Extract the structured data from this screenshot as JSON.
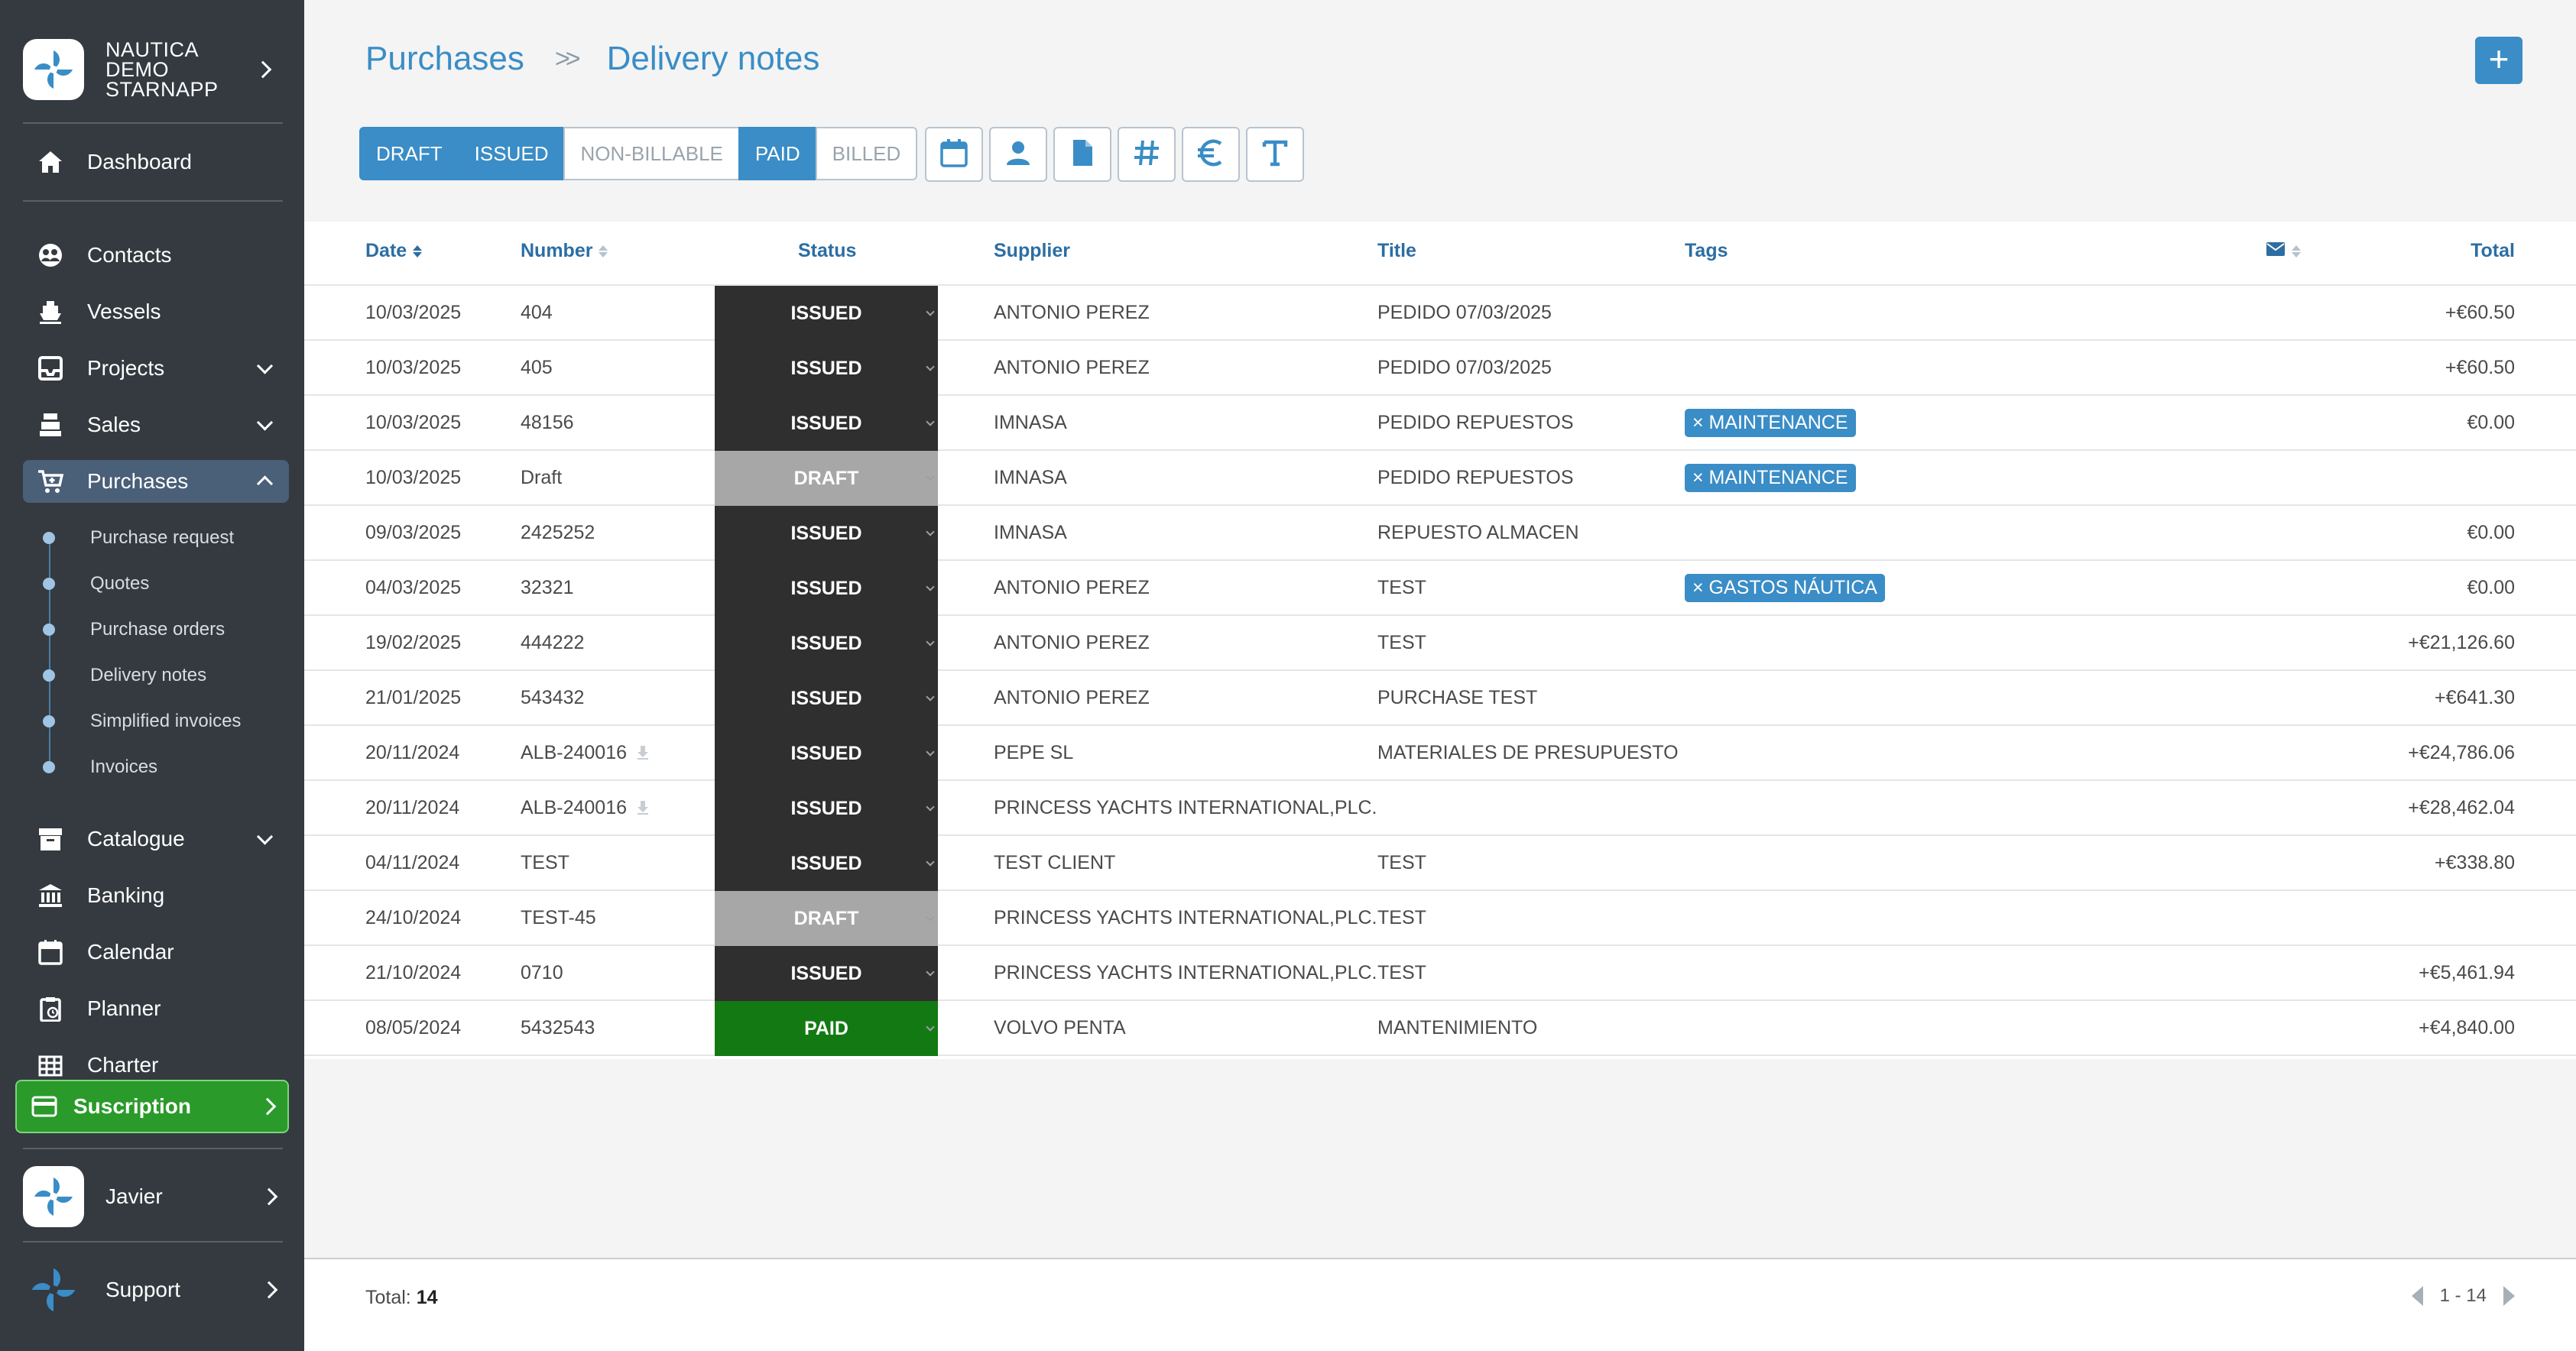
{
  "sidebar": {
    "org_name": "NAUTICA DEMO STARNAPP",
    "dashboard": "Dashboard",
    "items": [
      {
        "label": "Contacts",
        "icon": "contacts-icon"
      },
      {
        "label": "Vessels",
        "icon": "vessel-icon"
      },
      {
        "label": "Projects",
        "icon": "inbox-icon"
      },
      {
        "label": "Sales",
        "icon": "cash-register-icon"
      },
      {
        "label": "Purchases",
        "icon": "cart-icon"
      }
    ],
    "purchases_sub": [
      "Purchase request",
      "Quotes",
      "Purchase orders",
      "Delivery notes",
      "Simplified invoices",
      "Invoices"
    ],
    "items2": [
      {
        "label": "Catalogue",
        "icon": "archive-icon"
      },
      {
        "label": "Banking",
        "icon": "bank-icon"
      },
      {
        "label": "Calendar",
        "icon": "calendar-icon"
      },
      {
        "label": "Planner",
        "icon": "clipboard-icon"
      },
      {
        "label": "Charter",
        "icon": "grid-icon"
      }
    ],
    "subscription": "Suscription",
    "user": "Javier",
    "support": "Support"
  },
  "header": {
    "breadcrumb_parent": "Purchases",
    "breadcrumb_current": "Delivery notes",
    "add_label": "+"
  },
  "filters": {
    "segments": [
      {
        "label": "DRAFT",
        "active": true
      },
      {
        "label": "ISSUED",
        "active": true
      },
      {
        "label": "NON-BILLABLE",
        "active": false
      },
      {
        "label": "PAID",
        "active": true
      },
      {
        "label": "BILLED",
        "active": false
      }
    ],
    "icon_filters": [
      "calendar-icon",
      "person-icon",
      "document-icon",
      "hash-icon",
      "euro-icon",
      "text-icon"
    ]
  },
  "table": {
    "columns": {
      "date": "Date",
      "number": "Number",
      "status": "Status",
      "supplier": "Supplier",
      "title": "Title",
      "tags": "Tags",
      "total": "Total"
    },
    "rows": [
      {
        "date": "10/03/2025",
        "number": "404",
        "status": "ISSUED",
        "supplier": "ANTONIO PEREZ",
        "title": "PEDIDO 07/03/2025",
        "tag": "",
        "total": "+€60.50",
        "download": false
      },
      {
        "date": "10/03/2025",
        "number": "405",
        "status": "ISSUED",
        "supplier": "ANTONIO PEREZ",
        "title": "PEDIDO 07/03/2025",
        "tag": "",
        "total": "+€60.50",
        "download": false
      },
      {
        "date": "10/03/2025",
        "number": "48156",
        "status": "ISSUED",
        "supplier": "IMNASA",
        "title": "PEDIDO REPUESTOS",
        "tag": "× MAINTENANCE",
        "total": "€0.00",
        "download": false
      },
      {
        "date": "10/03/2025",
        "number": "Draft",
        "status": "DRAFT",
        "supplier": "IMNASA",
        "title": "PEDIDO REPUESTOS",
        "tag": "× MAINTENANCE",
        "total": "",
        "download": false
      },
      {
        "date": "09/03/2025",
        "number": "2425252",
        "status": "ISSUED",
        "supplier": "IMNASA",
        "title": "REPUESTO ALMACEN",
        "tag": "",
        "total": "€0.00",
        "download": false
      },
      {
        "date": "04/03/2025",
        "number": "32321",
        "status": "ISSUED",
        "supplier": "ANTONIO PEREZ",
        "title": "TEST",
        "tag": "× GASTOS NÁUTICA",
        "total": "€0.00",
        "download": false
      },
      {
        "date": "19/02/2025",
        "number": "444222",
        "status": "ISSUED",
        "supplier": "ANTONIO PEREZ",
        "title": "TEST",
        "tag": "",
        "total": "+€21,126.60",
        "download": false
      },
      {
        "date": "21/01/2025",
        "number": "543432",
        "status": "ISSUED",
        "supplier": "ANTONIO PEREZ",
        "title": "PURCHASE TEST",
        "tag": "",
        "total": "+€641.30",
        "download": false
      },
      {
        "date": "20/11/2024",
        "number": "ALB-240016",
        "status": "ISSUED",
        "supplier": "PEPE SL",
        "title": "MATERIALES DE PRESUPUESTO",
        "tag": "",
        "total": "+€24,786.06",
        "download": true
      },
      {
        "date": "20/11/2024",
        "number": "ALB-240016",
        "status": "ISSUED",
        "supplier": "PRINCESS YACHTS INTERNATIONAL,PLC.",
        "title": "",
        "tag": "",
        "total": "+€28,462.04",
        "download": true
      },
      {
        "date": "04/11/2024",
        "number": "TEST",
        "status": "ISSUED",
        "supplier": "TEST CLIENT",
        "title": "TEST",
        "tag": "",
        "total": "+€338.80",
        "download": false
      },
      {
        "date": "24/10/2024",
        "number": "TEST-45",
        "status": "DRAFT",
        "supplier": "PRINCESS YACHTS INTERNATIONAL,PLC.",
        "title": "TEST",
        "tag": "",
        "total": "",
        "download": false
      },
      {
        "date": "21/10/2024",
        "number": "0710",
        "status": "ISSUED",
        "supplier": "PRINCESS YACHTS INTERNATIONAL,PLC.",
        "title": "TEST",
        "tag": "",
        "total": "+€5,461.94",
        "download": false
      },
      {
        "date": "08/05/2024",
        "number": "5432543",
        "status": "PAID",
        "supplier": "VOLVO PENTA",
        "title": "MANTENIMIENTO",
        "tag": "",
        "total": "+€4,840.00",
        "download": false
      }
    ]
  },
  "footer": {
    "total_label": "Total:",
    "total_count": "14",
    "page_range": "1 - 14"
  },
  "colors": {
    "sidebar_bg": "#343a40",
    "accent": "#3a8dc6",
    "issued": "#2f2f2f",
    "draft": "#a7a7a7",
    "paid": "#137a13",
    "subscription": "#2a9a2a"
  }
}
